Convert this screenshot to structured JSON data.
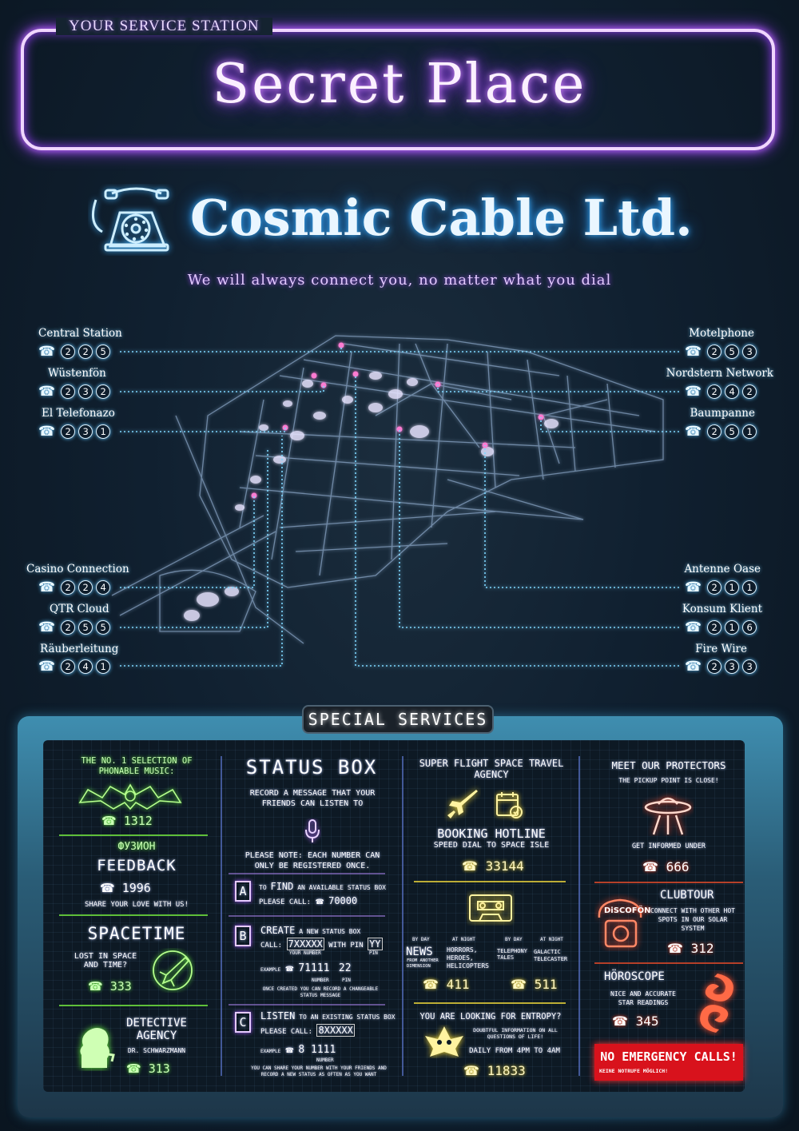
{
  "header": {
    "frame_label": "YOUR SERVICE STATION",
    "title": "Secret Place",
    "company": "Cosmic Cable Ltd.",
    "slogan": "We will always connect you, no matter what you dial"
  },
  "connections_left": [
    {
      "name": "Central Station",
      "digits": [
        "2",
        "2",
        "5"
      ]
    },
    {
      "name": "Wüstenfön",
      "digits": [
        "2",
        "3",
        "2"
      ]
    },
    {
      "name": "El Telefonazo",
      "digits": [
        "2",
        "3",
        "1"
      ]
    },
    {
      "name": "Casino Connection",
      "digits": [
        "2",
        "2",
        "4"
      ]
    },
    {
      "name": "QTR Cloud",
      "digits": [
        "2",
        "5",
        "5"
      ]
    },
    {
      "name": "Räuberleitung",
      "digits": [
        "2",
        "4",
        "1"
      ]
    }
  ],
  "connections_right": [
    {
      "name": "Motelphone",
      "digits": [
        "2",
        "5",
        "3"
      ]
    },
    {
      "name": "Nordstern Network",
      "digits": [
        "2",
        "4",
        "2"
      ]
    },
    {
      "name": "Baumpanne",
      "digits": [
        "2",
        "5",
        "1"
      ]
    },
    {
      "name": "Antenne Oase",
      "digits": [
        "2",
        "1",
        "1"
      ]
    },
    {
      "name": "Konsum Klient",
      "digits": [
        "2",
        "1",
        "6"
      ]
    },
    {
      "name": "Fire Wire",
      "digits": [
        "2",
        "3",
        "3"
      ]
    }
  ],
  "phone_glyph": "☎",
  "services": {
    "title": "SPECIAL SERVICES",
    "col1": {
      "music_label": "THE NO. 1 SELECTION OF PHONABLE MUSIC:",
      "music_number": "1312",
      "feedback_brand": "ФУЗИОН",
      "feedback_title": "FEEDBACK",
      "feedback_number": "1996",
      "feedback_sub": "SHARE YOUR LOVE WITH US!",
      "spacetime_title": "SPACETIME",
      "spacetime_sub": "LOST IN SPACE AND TIME?",
      "spacetime_number": "333",
      "detective_title": "DETECTIVE AGENCY",
      "detective_sub": "DR. SCHWARZMANN",
      "detective_number": "313"
    },
    "col2": {
      "title": "STATUS BOX",
      "intro": "RECORD A MESSAGE THAT YOUR FRIENDS CAN LISTEN TO",
      "note": "PLEASE NOTE: EACH NUMBER CAN ONLY BE REGISTERED ONCE.",
      "a_letter": "A",
      "a_line1_big": "FIND",
      "a_line1_pre": "TO",
      "a_line1_post": "AN AVAILABLE STATUS BOX",
      "a_line2": "PLEASE CALL:",
      "a_number": "70000",
      "b_letter": "B",
      "b_line1_big": "CREATE",
      "b_line1_post": "A NEW STATUS BOX",
      "b_call": "CALL:",
      "b_code": "7XXXXX",
      "b_with_pin": "WITH PIN",
      "b_pin": "YY",
      "b_label_number": "YOUR NUMBER",
      "b_label_pin": "PIN",
      "b_example": "EXAMPLE",
      "b_example_number": "71111",
      "b_example_pin": "22",
      "b_example_label_number": "NUMBER",
      "b_example_label_pin": "PIN",
      "b_note": "ONCE CREATED YOU CAN RECORD A CHANGEABLE STATUS MESSAGE",
      "c_letter": "C",
      "c_line1_big": "LISTEN",
      "c_line1_post": "TO AN EXISTING STATUS BOX",
      "c_call": "PLEASE CALL:",
      "c_code": "8XXXXX",
      "c_example": "EXAMPLE",
      "c_example_number": "8 1111",
      "c_example_label": "NUMBER",
      "c_note": "YOU CAN SHARE YOUR NUMBER WITH YOUR FRIENDS AND RECORD A NEW STATUS AS OFTEN AS YOU WANT"
    },
    "col3": {
      "agency_title": "SUPER FLIGHT SPACE TRAVEL AGENCY",
      "booking_title": "BOOKING HOTLINE",
      "booking_sub": "SPEED DIAL TO SPACE ISLE",
      "booking_number": "33144",
      "by_day_1": "BY DAY",
      "at_night_1": "AT NIGHT",
      "by_day_2": "BY DAY",
      "at_night_2": "AT NIGHT",
      "news_title": "NEWS",
      "news_sub": "FROM ANOTHER DIMENSION",
      "horrors": "HORRORS, HEROES, HELICOPTERS",
      "news_number": "411",
      "telephony_tales": "TELEPHONY TALES",
      "galactic": "GALACTIC TELECASTER",
      "tales_number": "511",
      "entropy_title": "YOU ARE LOOKING FOR ENTROPY?",
      "entropy_sub": "DOUBTFUL INFORMATION ON ALL QUESTIONS OF LIFE!",
      "entropy_hours": "DAILY FROM 4PM TO 4AM",
      "entropy_number": "11833"
    },
    "col4": {
      "protectors_title": "MEET OUR PROTECTORS",
      "protectors_sub": "THE PICKUP POINT IS CLOSE!",
      "informed": "GET INFORMED UNDER",
      "protectors_number": "666",
      "disco_brand": "DiSCOFÖN",
      "clubtour_title": "CLUBTOUR",
      "clubtour_sub": "CONNECT WITH OTHER HOT SPOTS IN OUR SOLAR SYSTEM",
      "clubtour_number": "312",
      "horoscope_title": "HÖROSCOPE",
      "horoscope_sub": "NICE AND ACCURATE STAR READINGS",
      "horoscope_number": "345",
      "emergency_title": "NO EMERGENCY CALLS!",
      "emergency_sub": "KEINE NOTRUFE MÖGLICH!"
    }
  },
  "colors": {
    "neon_purple": "#c06bff",
    "neon_blue": "#3fb2ff",
    "green": "#6cff3e",
    "yellow": "#ffe23a",
    "red": "#ff4d2e",
    "emergency_bg": "#d8121c"
  }
}
